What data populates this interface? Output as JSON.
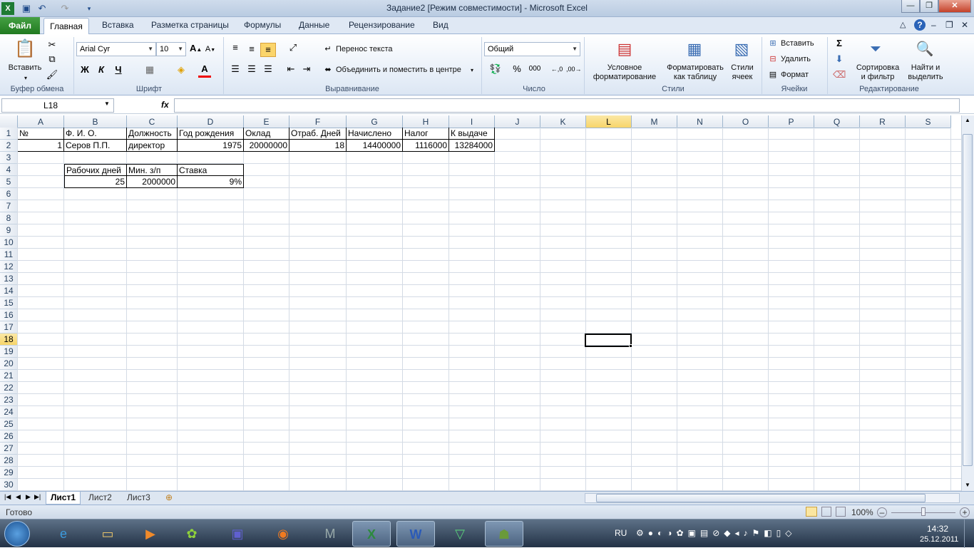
{
  "window": {
    "title": "Задание2  [Режим совместимости]  -  Microsoft Excel"
  },
  "tabs": [
    "Файл",
    "Главная",
    "Вставка",
    "Разметка страницы",
    "Формулы",
    "Данные",
    "Рецензирование",
    "Вид"
  ],
  "ribbon": {
    "paste": "Вставить",
    "font_name": "Arial Cyr",
    "font_size": "10",
    "bold": "Ж",
    "italic": "К",
    "underline": "Ч",
    "wrap": "Перенос текста",
    "merge": "Объединить и поместить в центре",
    "number_format": "Общий",
    "cond_fmt_1": "Условное",
    "cond_fmt_2": "форматирование",
    "fmt_table_1": "Форматировать",
    "fmt_table_2": "как таблицу",
    "styles_1": "Стили",
    "styles_2": "ячеек",
    "insert": "Вставить",
    "delete": "Удалить",
    "format": "Формат",
    "sort_1": "Сортировка",
    "sort_2": "и фильтр",
    "find_1": "Найти и",
    "find_2": "выделить",
    "groups": {
      "clipboard": "Буфер обмена",
      "font": "Шрифт",
      "alignment": "Выравнивание",
      "number": "Число",
      "styles": "Стили",
      "cells": "Ячейки",
      "editing": "Редактирование"
    }
  },
  "formula_bar": {
    "name_box": "L18",
    "fx": "fx",
    "value": ""
  },
  "columns": [
    "A",
    "B",
    "C",
    "D",
    "E",
    "F",
    "G",
    "H",
    "I",
    "J",
    "K",
    "L",
    "M",
    "N",
    "O",
    "P",
    "Q",
    "R",
    "S"
  ],
  "selected_cell": {
    "col": "L",
    "row": 18
  },
  "rows_visible": 30,
  "table1": {
    "headers": [
      "№",
      "Ф. И. О.",
      "Должность",
      "Год рождения",
      "Оклад",
      "Отраб. Дней",
      "Начислено",
      "Налог",
      "К выдаче"
    ],
    "row": [
      "1",
      "Серов П.П.",
      "директор",
      "1975",
      "20000000",
      "18",
      "14400000",
      "1116000",
      "13284000"
    ]
  },
  "table2": {
    "headers": [
      "Рабочих дней",
      "Мин. з/п",
      "Ставка"
    ],
    "row": [
      "25",
      "2000000",
      "9%"
    ]
  },
  "sheets": [
    "Лист1",
    "Лист2",
    "Лист3"
  ],
  "active_sheet": "Лист1",
  "status": {
    "ready": "Готово",
    "zoom": "100%"
  },
  "taskbar": {
    "lang": "RU",
    "time": "14:32",
    "date": "25.12.2011"
  }
}
